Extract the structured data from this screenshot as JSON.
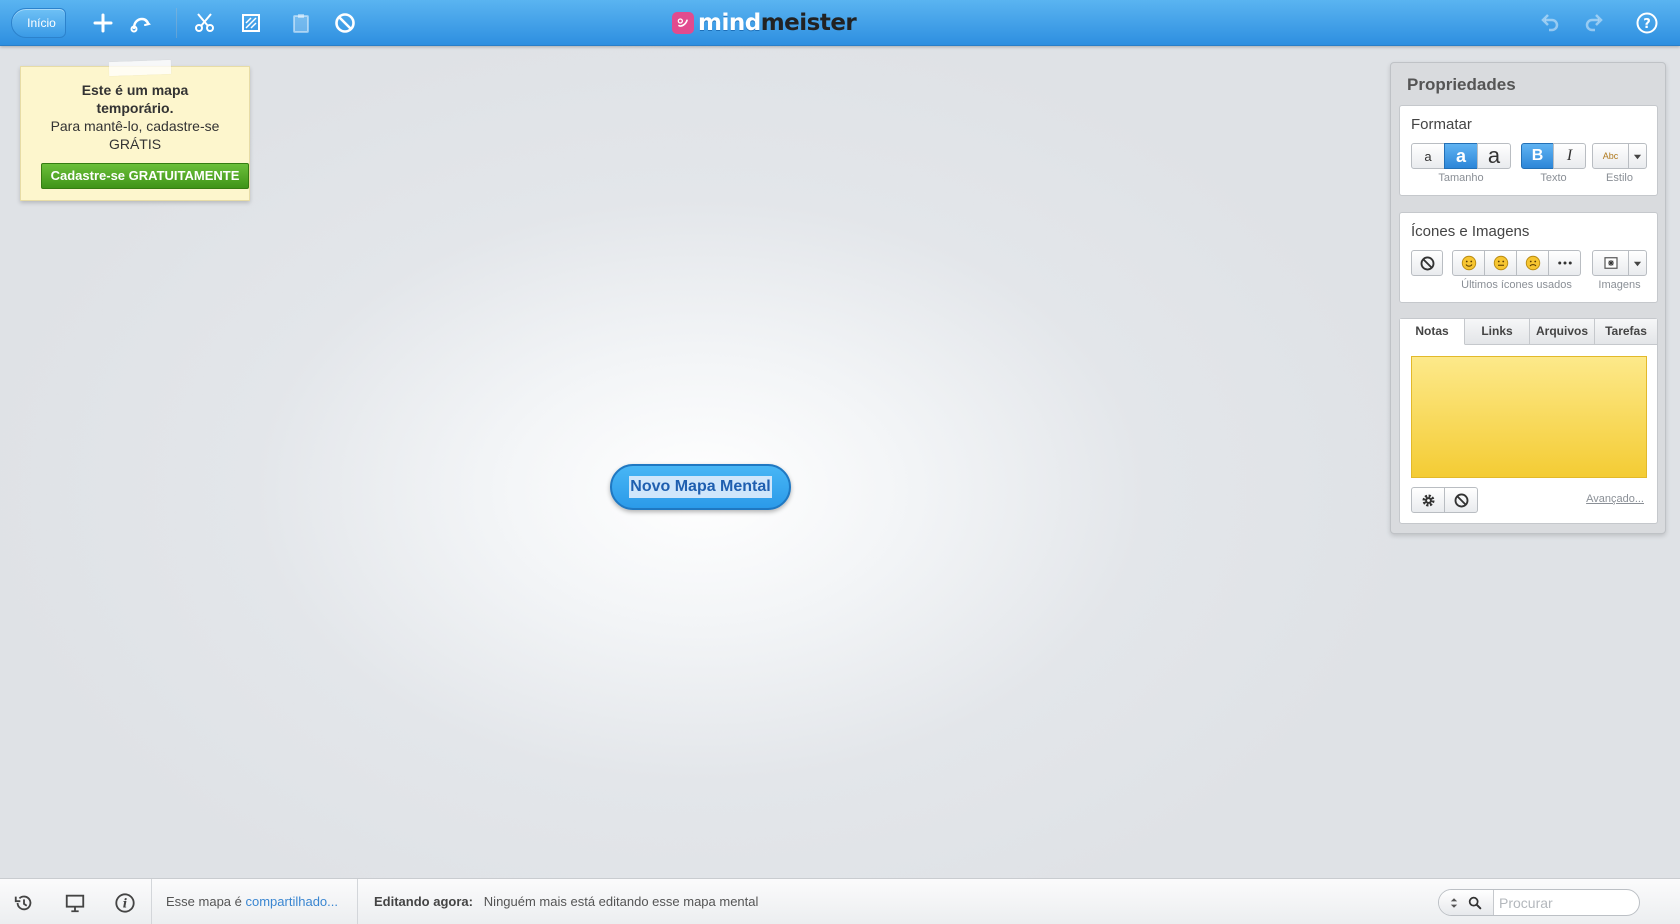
{
  "toolbar": {
    "back_label": "Início",
    "logo_text_a": "mind",
    "logo_text_b": "meister",
    "icons": [
      "plus-icon",
      "connect-icon",
      "cut-icon",
      "copy-icon",
      "paste-icon",
      "delete-icon",
      "undo-icon",
      "redo-icon",
      "help-icon"
    ]
  },
  "temp_note": {
    "title": "Este é um mapa temporário.",
    "subtitle": "Para mantê-lo, cadastre-se GRÁTIS",
    "signup_label": "Cadastre-se GRATUITAMENTE"
  },
  "canvas": {
    "central_node_text": "Novo Mapa Mental"
  },
  "properties": {
    "title": "Propriedades",
    "format": {
      "title": "Formatar",
      "size_buttons": [
        "a",
        "a",
        "a"
      ],
      "size_selected_index": 1,
      "size_caption": "Tamanho",
      "bold_label": "B",
      "italic_label": "I",
      "text_caption": "Texto",
      "style_sample": "Abc",
      "style_caption": "Estilo"
    },
    "icons_images": {
      "title": "Ícones e Imagens",
      "recent_caption": "Últimos ícones usados",
      "images_caption": "Imagens"
    },
    "tabs": [
      "Notas",
      "Links",
      "Arquivos",
      "Tarefas"
    ],
    "active_tab": "Notas",
    "advanced_link": "Avançado..."
  },
  "statusbar": {
    "share_prefix": "Esse mapa é ",
    "share_link": "compartilhado...",
    "editing_label": "Editando agora:",
    "editing_value": "Ninguém mais está editando esse mapa mental",
    "search_placeholder": "Procurar"
  },
  "colors": {
    "toolbar_blue": "#3a9ae6",
    "node_blue": "#2b9ae9",
    "signup_green": "#4fa022",
    "note_yellow": "#f4cc34"
  }
}
